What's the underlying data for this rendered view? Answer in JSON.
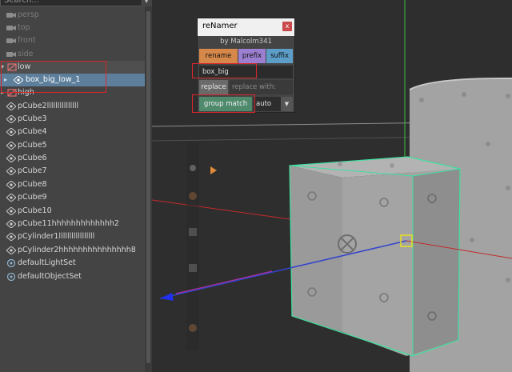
{
  "outliner": {
    "search_placeholder": "Search...",
    "cameras": [
      "persp",
      "top",
      "front",
      "side"
    ],
    "group_low": "low",
    "selected_item": "box_big_low_1",
    "group_high": "high",
    "meshes": [
      "pCube2lllllllllllllll",
      "pCube3",
      "pCube4",
      "pCube5",
      "pCube6",
      "pCube7",
      "pCube8",
      "pCube9",
      "pCube10",
      "pCube11hhhhhhhhhhhhh2",
      "pCylinder1lllllllllllllllll",
      "pCylinder2hhhhhhhhhhhhhhh8"
    ],
    "sets": [
      "defaultLightSet",
      "defaultObjectSet"
    ]
  },
  "renamer": {
    "title": "reNamer",
    "close_label": "x",
    "byline": "by Malcolm341",
    "rename_label": "rename",
    "prefix_label": "prefix",
    "suffix_label": "suffix",
    "name_value": "box_big",
    "replace_label": "replace",
    "replace_placeholder": "replace with:",
    "group_match_label": "group match",
    "mode_value": "auto",
    "colors": {
      "rename": "#d6884a",
      "prefix": "#9c7fd1",
      "suffix": "#5c9ec8",
      "group_match": "#4f8a6c"
    }
  },
  "viewport": {
    "icons": [
      "visibility-icon",
      "light-icon",
      "shading-icon",
      "camera-icon"
    ]
  },
  "colors": {
    "selection_highlight": "#5d7f9b",
    "annotation_red": "#d9262a",
    "wireframe_green": "#3fe0a0"
  }
}
